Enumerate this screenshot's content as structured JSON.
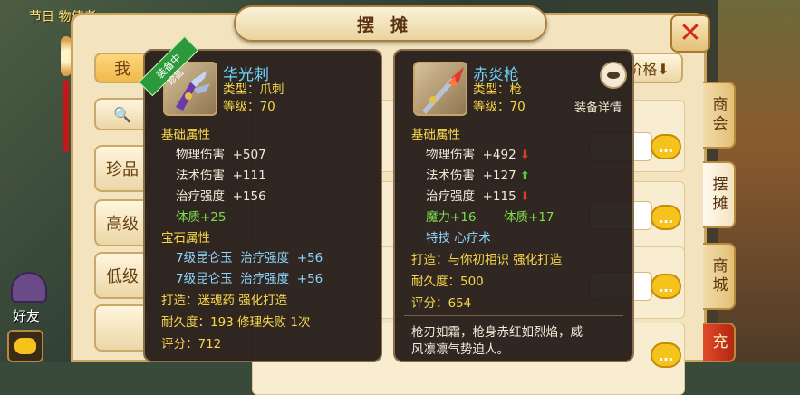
{
  "festival_text": "节日",
  "festival_text_2": "物使者",
  "panel_title": "摆摊",
  "close_glyph": "✕",
  "sidebar": {
    "items": [
      {
        "label": "我"
      },
      {
        "label": ""
      },
      {
        "label": "珍品"
      },
      {
        "label": "高级"
      },
      {
        "label": "低级"
      },
      {
        "label": ""
      }
    ]
  },
  "sort_button": "价格⬇",
  "right_tabs": [
    {
      "label": "商会"
    },
    {
      "label": "摆摊"
    },
    {
      "label": "商城"
    },
    {
      "label": "充"
    }
  ],
  "friend_label": "好友",
  "tooltip_left": {
    "ribbon": "装备中",
    "ribbon2": "珍品",
    "name": "华光刺",
    "type": "类型：爪刺",
    "level": "等级：70",
    "base_header": "基础属性",
    "stats": [
      {
        "label": "物理伤害",
        "value": "+507"
      },
      {
        "label": "法术伤害",
        "value": "+111"
      },
      {
        "label": "治疗强度",
        "value": "+156"
      }
    ],
    "bonus": "体质+25",
    "gem_header": "宝石属性",
    "gems": [
      {
        "name": "7级昆仑玉",
        "stat": "治疗强度",
        "value": "+56"
      },
      {
        "name": "7级昆仑玉",
        "stat": "治疗强度",
        "value": "+56"
      }
    ],
    "forge": "打造：迷魂药   强化打造",
    "durability": "耐久度：193 修理失败 1次",
    "score": "评分：712"
  },
  "tooltip_right": {
    "name": "赤炎枪",
    "type": "类型：枪",
    "level": "等级：70",
    "detail_label": "装备详情",
    "base_header": "基础属性",
    "stats": [
      {
        "label": "物理伤害",
        "value": "+492",
        "trend": "down"
      },
      {
        "label": "法术伤害",
        "value": "+127",
        "trend": "up"
      },
      {
        "label": "治疗强度",
        "value": "+115",
        "trend": "down"
      }
    ],
    "bonus1": "魔力+16",
    "bonus2": "体质+17",
    "skill": "特技  心疗术",
    "forge": "打造：与你初相识   强化打造",
    "durability": "耐久度：500",
    "score": "评分：654",
    "desc_line1": "枪刃如霜，枪身赤红如烈焰，威",
    "desc_line2": "风凛凛气势迫人。"
  },
  "arrow_down": "⬇",
  "arrow_up": "⬆"
}
